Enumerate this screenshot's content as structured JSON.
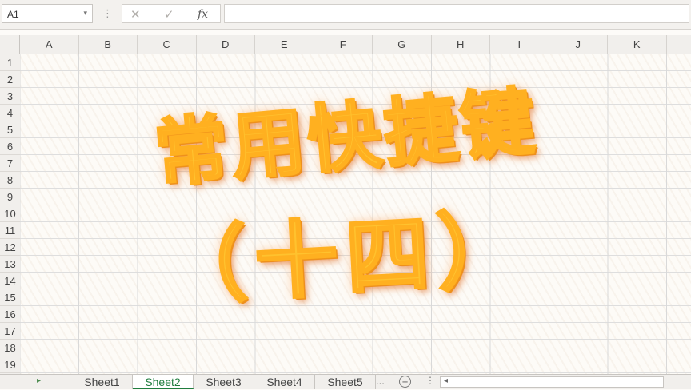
{
  "formula_bar": {
    "name_box": "A1",
    "name_box_dropdown": "▾",
    "separator": "⋮",
    "cancel_icon": "✕",
    "enter_icon": "✓",
    "fx_label": "fx",
    "formula_value": ""
  },
  "columns": [
    "A",
    "B",
    "C",
    "D",
    "E",
    "F",
    "G",
    "H",
    "I",
    "J",
    "K"
  ],
  "rows": [
    "1",
    "2",
    "3",
    "4",
    "5",
    "6",
    "7",
    "8",
    "9",
    "10",
    "11",
    "12",
    "13",
    "14",
    "15",
    "16",
    "17",
    "18",
    "19"
  ],
  "overlay": {
    "line1": "常用快捷键",
    "line2": "（十四）"
  },
  "sheet_tabs": {
    "nav_arrow": "▸",
    "tabs": [
      "Sheet1",
      "Sheet2",
      "Sheet3",
      "Sheet4",
      "Sheet5"
    ],
    "active": "Sheet2",
    "more": "...",
    "add": "+",
    "dots": "⋮"
  },
  "colors": {
    "title_fill": "#ffc22e",
    "title_shadow": "#f0941b",
    "active_tab": "#1f7d3e"
  }
}
